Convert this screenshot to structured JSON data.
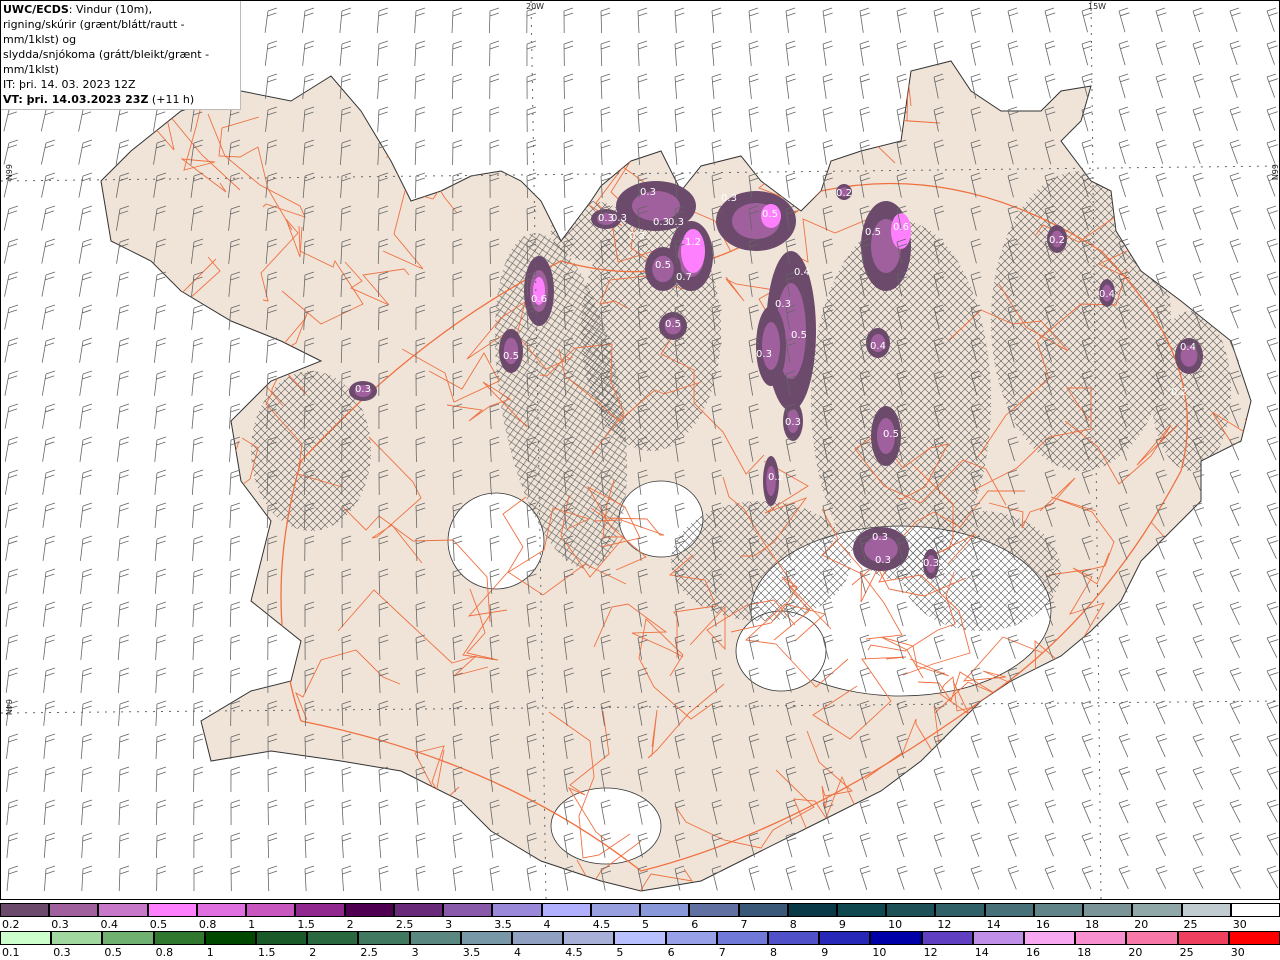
{
  "title": {
    "source": "UWC/ECDS",
    "line1_rest": ": Vindur (10m),",
    "line2": "rigning/skúrir (grænt/blátt/rautt - mm/1klst) og",
    "line3": "slydda/snjókoma (grátt/bleikt/grænt - mm/1klst)",
    "it": "IT: þri. 14. 03. 2023 12Z",
    "vt_bold": "VT: þri. 14.03.2023 23Z",
    "vt_rest": " (+11 h)"
  },
  "grid_labels": {
    "lon1": "20W",
    "lon2": "15W",
    "lat_top_left": "66N",
    "lat_top_right": "66N",
    "lat_bottom_left": "64N"
  },
  "map_colors": {
    "land": "#f0e4d8",
    "sea": "#ffffff",
    "glacier": "#ffffff",
    "roads": "#f07040",
    "coast": "#333333"
  },
  "precip_labels": [
    "0.3",
    "0.3",
    "0.3",
    "0.3",
    "0.3",
    "0.3",
    "1.2",
    "0.5",
    "0.7",
    "0.5",
    "0.6",
    "0.5",
    "0.3",
    "0.3",
    "0.5",
    "0.4",
    "0.3",
    "0.5",
    "0.3",
    "0.3",
    "0.2",
    "0.2",
    "0.5",
    "0.6",
    "0.4",
    "0.5",
    "0.3",
    "0.3",
    "0.3",
    "0.2",
    "0.4",
    "0.4",
    "0.2"
  ],
  "legend_snow": {
    "labels": [
      "0.2",
      "0.3",
      "0.4",
      "0.5",
      "0.8",
      "1",
      "1.5",
      "2",
      "2.5",
      "3",
      "3.5",
      "4",
      "4.5",
      "5",
      "6",
      "7",
      "8",
      "9",
      "10",
      "12",
      "14",
      "16",
      "18",
      "20",
      "25",
      "30"
    ],
    "colors": [
      "#6b4a6b",
      "#a0609e",
      "#c878c8",
      "#ff80ff",
      "#e070e0",
      "#c858c0",
      "#902890",
      "#500050",
      "#6a2a7a",
      "#8a5aaa",
      "#9a88d8",
      "#b0b0ff",
      "#98a0e0",
      "#8898d8",
      "#6070a0",
      "#3a5878",
      "#0a3a48",
      "#104850",
      "#1e5058",
      "#306068",
      "#487078",
      "#608488",
      "#7a9498",
      "#90a8a8",
      "#c0ccd0",
      "#ffffff"
    ]
  },
  "legend_rain": {
    "labels": [
      "0.1",
      "0.3",
      "0.5",
      "0.8",
      "1",
      "1.5",
      "2",
      "2.5",
      "3",
      "3.5",
      "4",
      "4.5",
      "5",
      "6",
      "7",
      "8",
      "9",
      "10",
      "12",
      "14",
      "16",
      "18",
      "20",
      "25",
      "30"
    ],
    "colors": [
      "#ccffcc",
      "#a0d8a0",
      "#70b070",
      "#307830",
      "#004800",
      "#1a5a28",
      "#2a6840",
      "#407860",
      "#5a8880",
      "#7898a8",
      "#90a0c0",
      "#a8b0d8",
      "#b8c0ff",
      "#98a0e8",
      "#7078d8",
      "#5050c8",
      "#2828b8",
      "#0000a8",
      "#6040c0",
      "#c090e8",
      "#f8a8f0",
      "#f890d0",
      "#f878a8",
      "#f04060",
      "#ff0000"
    ]
  }
}
